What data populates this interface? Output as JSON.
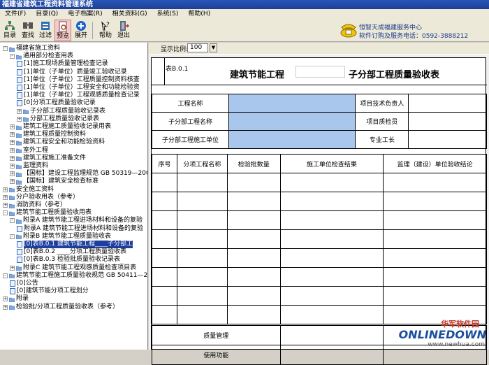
{
  "window": {
    "title": "福建省建筑工程资料管理系统"
  },
  "menu": [
    "文件(F)",
    "目录(Q)",
    "电子档案(R)",
    "相关资料(G)",
    "系统(S)",
    "帮助(H)"
  ],
  "toolbar": {
    "buttons": [
      {
        "label": "目录",
        "icon": "tree-icon"
      },
      {
        "label": "查找",
        "icon": "find-icon"
      },
      {
        "label": "过滤",
        "icon": "filter-icon"
      },
      {
        "label": "预览",
        "icon": "preview-icon"
      },
      {
        "label": "展开",
        "icon": "expand-icon"
      },
      {
        "label": "帮助",
        "icon": "help-icon"
      },
      {
        "label": "退出",
        "icon": "exit-icon"
      }
    ],
    "service_line1": "恒智天成福建服务中心",
    "service_line2": "软件订购及服务电话：0592-3888212"
  },
  "tree": [
    {
      "text": "福建省施工资料",
      "level": 0,
      "expander": "-",
      "kind": "folder"
    },
    {
      "text": "通用部分检查用表",
      "level": 1,
      "expander": "-",
      "kind": "folder"
    },
    {
      "text": "[1]施工现场质量管理检查记录",
      "level": 2,
      "kind": "doc"
    },
    {
      "text": "[1]单位（子单位）质量竣工验收记录",
      "level": 2,
      "kind": "doc"
    },
    {
      "text": "[1]单位（子单位）工程质量控制资料核查",
      "level": 2,
      "kind": "doc"
    },
    {
      "text": "[1]单位（子单位）工程安全和功能检验资",
      "level": 2,
      "kind": "doc"
    },
    {
      "text": "[1]单位（子单位）工程观感质量检查记录",
      "level": 2,
      "kind": "doc"
    },
    {
      "text": "[0]分项工程质量验收记录",
      "level": 2,
      "kind": "doc"
    },
    {
      "text": "子分部工程质量验收记录表",
      "level": 2,
      "expander": "+",
      "kind": "folder"
    },
    {
      "text": "分部工程质量验收记录表",
      "level": 2,
      "expander": "+",
      "kind": "folder"
    },
    {
      "text": "建筑工程施工质量验收记录用表",
      "level": 1,
      "expander": "+",
      "kind": "folder"
    },
    {
      "text": "建筑工程质量控制资料",
      "level": 1,
      "expander": "+",
      "kind": "folder"
    },
    {
      "text": "建筑工程安全和功能检验资料",
      "level": 1,
      "expander": "+",
      "kind": "folder"
    },
    {
      "text": "室外工程",
      "level": 1,
      "expander": "+",
      "kind": "folder"
    },
    {
      "text": "建筑工程施工准备文件",
      "level": 1,
      "expander": "+",
      "kind": "folder"
    },
    {
      "text": "监理资料",
      "level": 1,
      "expander": "+",
      "kind": "folder"
    },
    {
      "text": "【国标】建设工程监理规范 GB 50319—200",
      "level": 1,
      "expander": "+",
      "kind": "folder"
    },
    {
      "text": "【国标】建筑安全检查标准",
      "level": 1,
      "expander": "+",
      "kind": "folder"
    },
    {
      "text": "安全施工资料",
      "level": 0,
      "expander": "+",
      "kind": "folder"
    },
    {
      "text": "分户验收用表（参考）",
      "level": 0,
      "expander": "+",
      "kind": "folder"
    },
    {
      "text": "消防资料（参考）",
      "level": 0,
      "expander": "+",
      "kind": "folder"
    },
    {
      "text": "建筑节能工程质量验收用表",
      "level": 0,
      "expander": "-",
      "kind": "folder"
    },
    {
      "text": "附录A 建筑节能工程进场材料和设备的复验",
      "level": 1,
      "expander": "-",
      "kind": "folder"
    },
    {
      "text": "附录A 建筑节能工程进场材料和设备的复验",
      "level": 2,
      "kind": "doc"
    },
    {
      "text": "附录B 建筑节能工程质量验收表",
      "level": 1,
      "expander": "-",
      "kind": "folder"
    },
    {
      "text": "[0]表B.0.1 建筑节能工程____子分部工",
      "level": 2,
      "kind": "doc",
      "selected": true
    },
    {
      "text": "[0]表B.0.2 ____分项工程质量验收表",
      "level": 2,
      "kind": "doc"
    },
    {
      "text": "[0]表B.0.3 检验批质量验收记录表",
      "level": 2,
      "kind": "doc"
    },
    {
      "text": "附录C 建筑节能工程观感质量检查项目表",
      "level": 1,
      "expander": "+",
      "kind": "folder"
    },
    {
      "text": "建筑节能工程施工质量验收规范 GB 50411—200",
      "level": 0,
      "expander": "-",
      "kind": "folder"
    },
    {
      "text": "[0]公告",
      "level": 1,
      "kind": "doc"
    },
    {
      "text": "[0]建筑节能分项工程划分",
      "level": 1,
      "kind": "doc"
    },
    {
      "text": "附录",
      "level": 0,
      "expander": "+",
      "kind": "folder"
    },
    {
      "text": "检验批/分项工程质量验收表（参考）",
      "level": 0,
      "expander": "+",
      "kind": "folder"
    }
  ],
  "zoom": {
    "label": "显示比例:",
    "value": "100"
  },
  "form": {
    "code": "表B.0.1",
    "title_left": "建筑节能工程",
    "title_right": "子分部工程质量验收表",
    "row1_label": "工程名称",
    "row1_right": "项目技术负责人",
    "row2_label": "子分部工程名称",
    "row2_right": "项目质检员",
    "row3_label": "子分部工程施工单位",
    "row3_right": "专业工长",
    "grid_headers": [
      "序号",
      "分项工程名称",
      "检验批数量",
      "施工单位检查结果",
      "监理（建设）单位验收结论"
    ],
    "bottom_rows": [
      "质量管理",
      "使用功能"
    ]
  },
  "watermark": {
    "top": "华军软件园",
    "mid": "ONLINEDOWN",
    "bot": "www.newhua.com"
  }
}
